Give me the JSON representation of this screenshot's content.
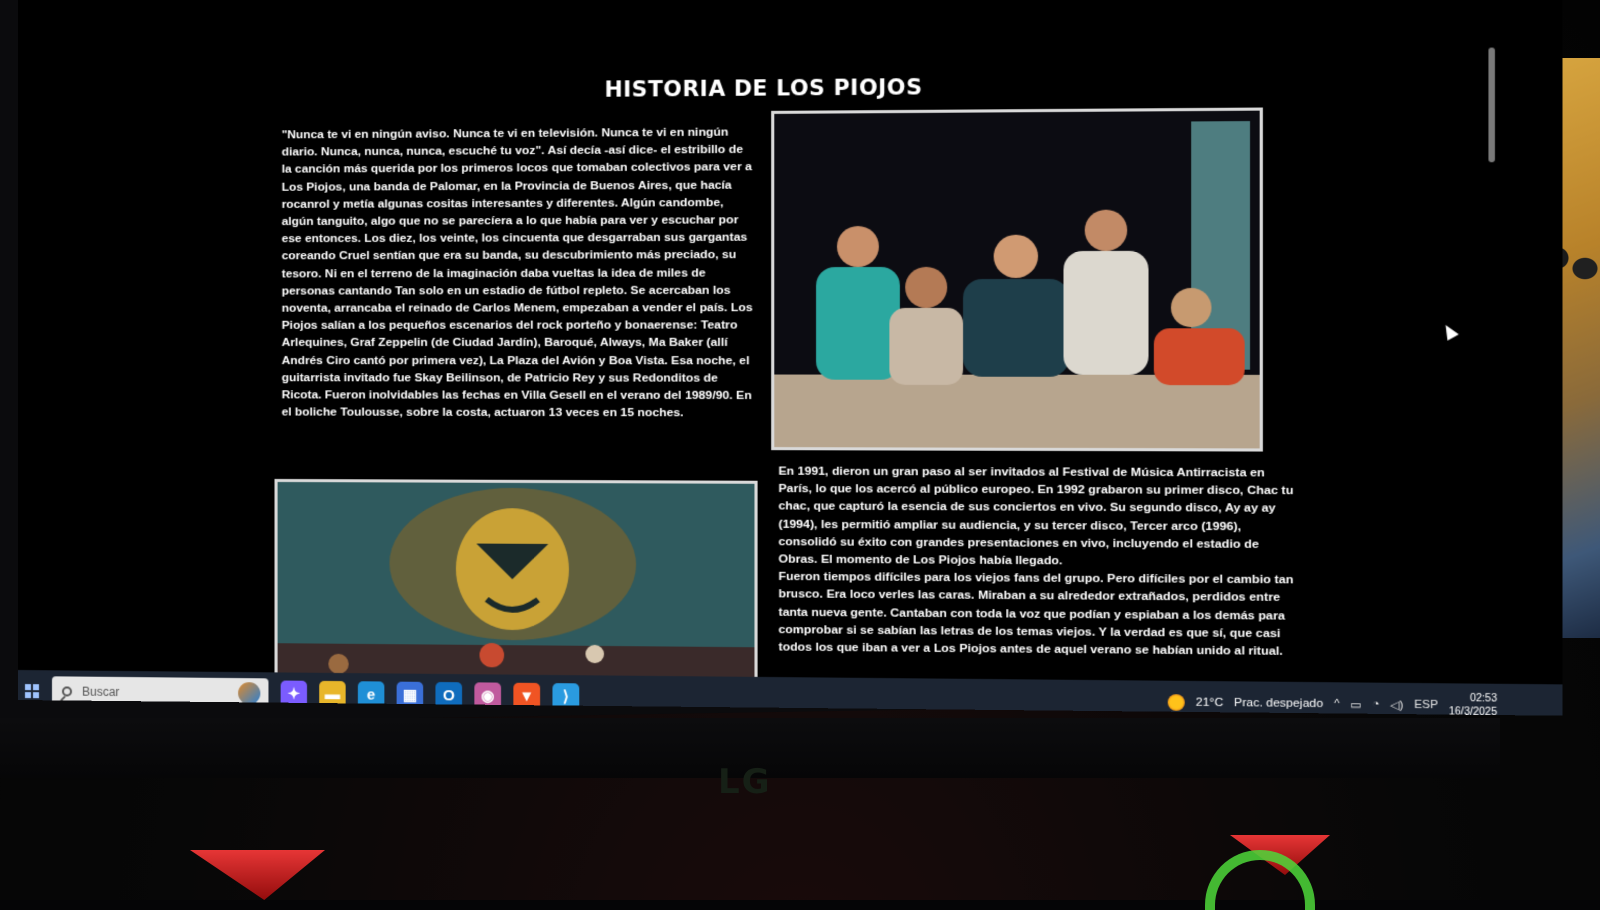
{
  "page": {
    "title": "HISTORIA DE LOS PIOJOS",
    "paragraph1": "\"Nunca te vi en ningún aviso. Nunca te vi en televisión. Nunca te vi en ningún diario. Nunca, nunca, nunca, escuché tu voz\". Así decía -así dice- el estribillo de la canción más querida por los primeros locos que tomaban colectivos para ver a Los Piojos, una banda de Palomar, en la Provincia de Buenos Aires, que hacía rocanrol y metía algunas cositas interesantes y diferentes. Algún candombe, algún tanguito, algo que no se parecíera a lo que había para ver y escuchar por ese entonces. Los diez, los veinte, los cincuenta que desgarraban sus gargantas coreando Cruel sentían que era su banda, su descubrimiento más preciado, su tesoro. Ni en el terreno de la imaginación daba vueltas la idea de miles de personas cantando Tan solo en un estadio de fútbol repleto. Se acercaban los noventa, arrancaba el reinado de Carlos Menem, empezaban a vender el país. Los Piojos salían a los pequeños escenarios del rock porteño y bonaerense: Teatro Arlequines, Graf Zeppelin (de Ciudad Jardín), Baroqué, Always, Ma Baker (allí Andrés Ciro cantó por primera vez), La Plaza del Avión y Boa Vista. Esa noche, el guitarrista invitado fue Skay Beilinson, de Patricio Rey y sus Redonditos de Ricota. Fueron inolvidables las fechas en Villa Gesell en el verano del 1989/90. En el boliche Toulousse, sobre la costa, actuaron 13 veces en 15 noches.",
    "paragraph2": "En 1991, dieron un gran paso al ser invitados al Festival de Música Antirracista en París, lo que los acercó al público europeo. En 1992 grabaron su primer disco, Chac tu chac, que capturó la esencia de sus conciertos en vivo. Su segundo disco, Ay ay ay (1994), les permitió ampliar su audiencia, y su tercer disco, Tercer arco (1996), consolidó su éxito con grandes presentaciones en vivo, incluyendo el estadio de Obras. El momento de Los Piojos había llegado.",
    "paragraph3": "Fueron tiempos difíciles para los viejos fans del grupo. Pero difíciles por el cambio tan brusco. Era loco verles las caras. Miraban a su alrededor extrañados, perdidos entre tanta nueva gente. Cantaban con toda la voz que podían y espiaban a los demás para comprobar si se sabían las letras de los temas viejos. Y la verdad es que sí, que casi todos los que iban a ver a Los Piojos antes de aquel verano se habían unido al ritual."
  },
  "taskbar": {
    "search_placeholder": "Buscar",
    "apps": [
      {
        "icon": "copilot-icon",
        "glyph": "✦",
        "color": "#7b5cff"
      },
      {
        "icon": "file-explorer-icon",
        "glyph": "▬",
        "color": "#e8b62a"
      },
      {
        "icon": "edge-browser-icon",
        "glyph": "e",
        "color": "#1f8fd6"
      },
      {
        "icon": "microsoft-store-icon",
        "glyph": "▦",
        "color": "#3a6fd8"
      },
      {
        "icon": "outlook-icon",
        "glyph": "O",
        "color": "#0f6cbd"
      },
      {
        "icon": "app-icon",
        "glyph": "◉",
        "color": "#c05a9e"
      },
      {
        "icon": "brave-browser-icon",
        "glyph": "▼",
        "color": "#f05423"
      },
      {
        "icon": "vscode-icon",
        "glyph": "⟩",
        "color": "#2a9be0"
      }
    ],
    "weather": {
      "temp": "21°C",
      "desc": "Prac. despejado"
    },
    "language": "ESP",
    "time": "02:53",
    "date": "16/3/2025"
  }
}
